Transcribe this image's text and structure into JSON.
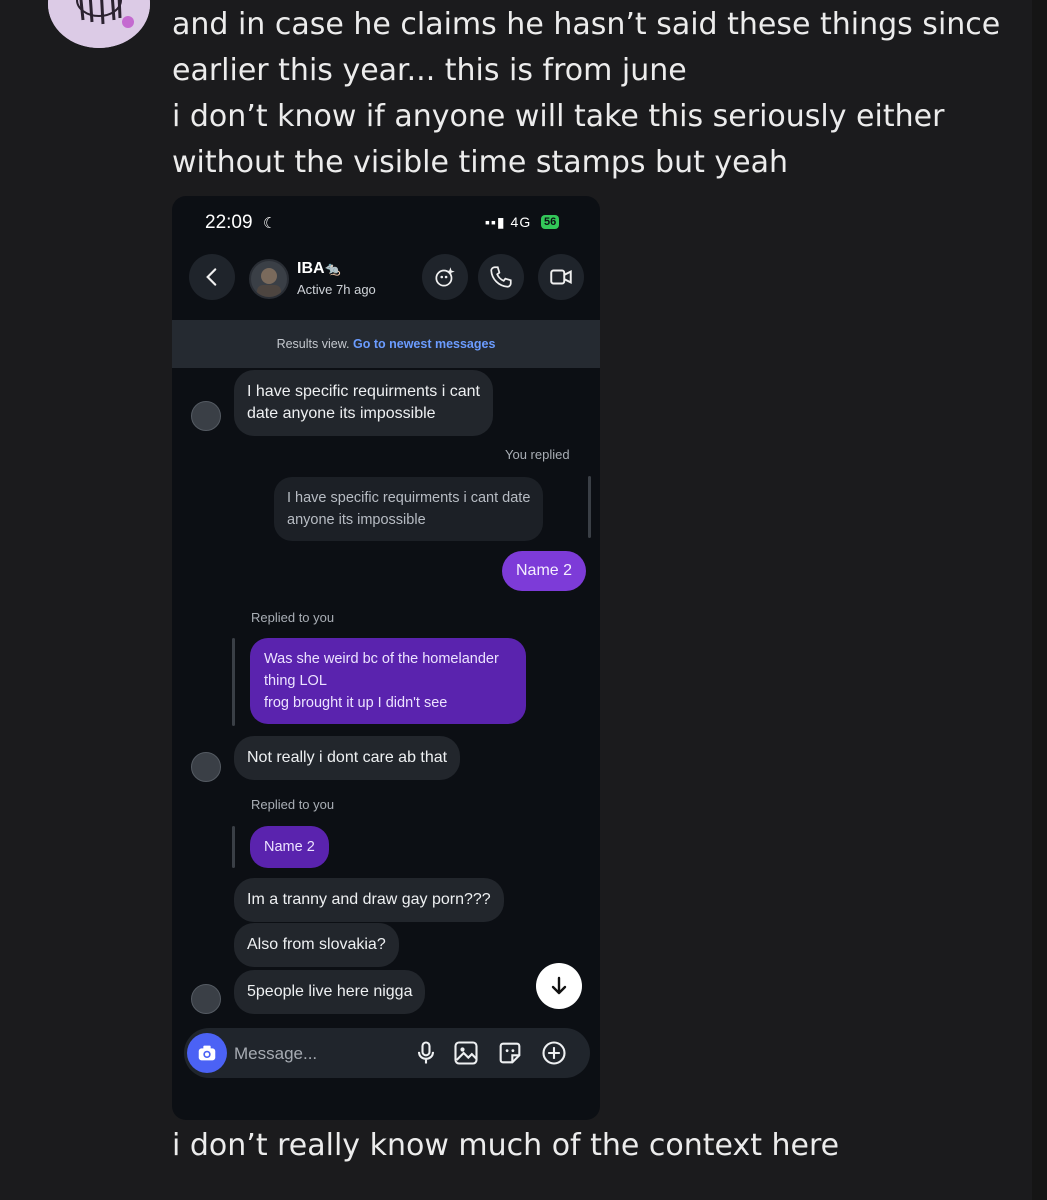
{
  "post": {
    "lines": [
      "and in case he claims he hasn’t said these things since",
      "earlier this year... this is from june",
      "i don’t know if anyone will take this seriously either",
      "without the visible time stamps but yeah"
    ],
    "footer": "i don’t really know much of the context here"
  },
  "phone": {
    "status": {
      "time": "22:09",
      "network": "4G",
      "battery": "56"
    },
    "header": {
      "name": "IBA",
      "name_emoji": "🐀",
      "status": "Active 7h ago"
    },
    "results_bar": {
      "text": "Results view.",
      "link": "Go to newest messages"
    },
    "messages": {
      "m1": [
        "I have specific requirments i cant",
        "date anyone its impossible"
      ],
      "you_replied": "You replied",
      "quoted": [
        "I have specific requirments i cant date",
        "anyone its impossible"
      ],
      "name2": "Name 2",
      "replied_to_you_1": "Replied to you",
      "reply1": [
        "Was she weird bc of the homelander",
        "thing LOL",
        "frog brought it up I didn't see"
      ],
      "m2": "Not really i dont care ab that",
      "replied_to_you_2": "Replied to you",
      "reply2": "Name 2",
      "m3": "Im a tranny and draw gay porn???",
      "m4": "Also from slovakia?",
      "m5": "5people live here nigga"
    },
    "composer": {
      "placeholder": "Message..."
    }
  }
}
